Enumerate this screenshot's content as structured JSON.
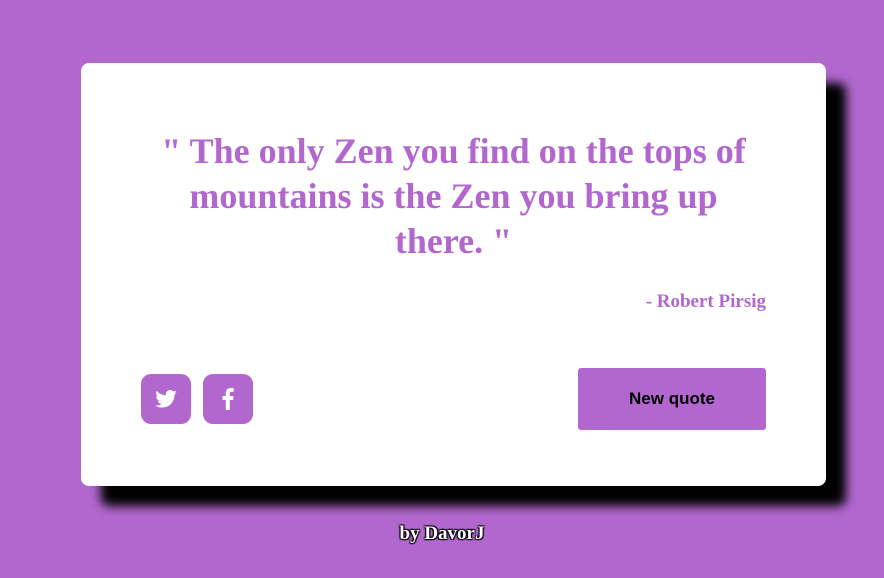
{
  "theme": {
    "accent": "#b167cd",
    "card_bg": "#ffffff",
    "shadow": "#000000"
  },
  "quote": {
    "text": "\" The only Zen you find on the tops of mountains is the Zen you bring up there. \"",
    "author": "- Robert Pirsig"
  },
  "share": {
    "twitter_icon": "twitter-icon",
    "facebook_icon": "facebook-icon"
  },
  "actions": {
    "new_quote_label": "New quote"
  },
  "footer": {
    "credit": "by DavorJ"
  }
}
